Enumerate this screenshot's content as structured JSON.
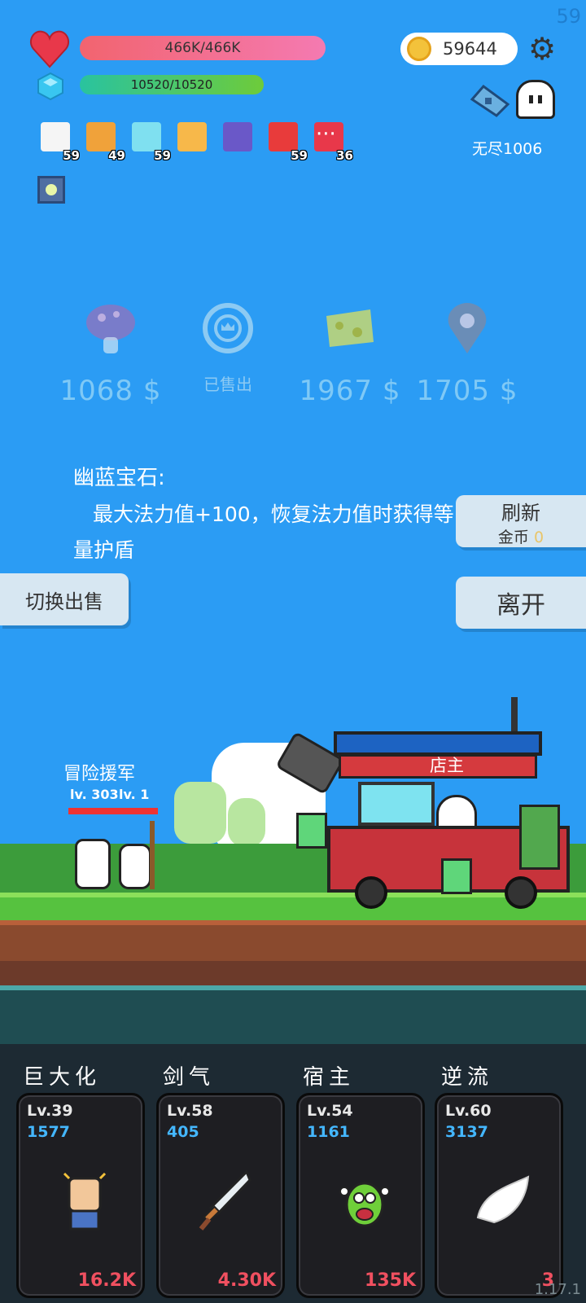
{
  "status": {
    "fps": "59",
    "version": "1.17.1"
  },
  "player": {
    "hp": "466K/466K",
    "mp": "10520/10520",
    "coins": "59644"
  },
  "mode": {
    "endless": "无尽1006"
  },
  "items": [
    {
      "icon": "flower-icon",
      "count": "59",
      "color": "#f5f5f5"
    },
    {
      "icon": "book-icon",
      "count": "49",
      "color": "#f0a23a"
    },
    {
      "icon": "sword-icon",
      "count": "59",
      "color": "#7fe0f0"
    },
    {
      "icon": "scroll-icon",
      "count": "",
      "color": "#f7b84a"
    },
    {
      "icon": "wizard-hat-icon",
      "count": "",
      "color": "#6a58c8"
    },
    {
      "icon": "apple-icon",
      "count": "59",
      "color": "#e83b3b"
    },
    {
      "icon": "heart-icon",
      "count": "36",
      "color": "#e8384a"
    }
  ],
  "more": "···",
  "shop": {
    "items": [
      {
        "icon": "mushroom-icon",
        "price": "1068 $"
      },
      {
        "icon": "crown-token-icon",
        "sold": "已售出"
      },
      {
        "icon": "cheese-icon",
        "price": "1967 $"
      },
      {
        "icon": "map-pin-icon",
        "price": "1705 $"
      }
    ],
    "desc_title": "幽蓝宝石:",
    "desc_body": "最大法力值+100，恢复法力值时获得等量护盾",
    "refresh_label": "刷新",
    "refresh_cost_label": "金币",
    "refresh_cost": "0",
    "leave_label": "离开",
    "switch_label": "切换出售"
  },
  "scene": {
    "ally_name": "冒险援军",
    "ally_lv_a": "lv. 303",
    "ally_lv_b": "lv. 1",
    "shopkeeper": "店主"
  },
  "skills": [
    {
      "name": "巨大化",
      "lv": "Lv.39",
      "power": "1577",
      "cost": "16.2K",
      "icon": "fist-icon"
    },
    {
      "name": "剑气",
      "lv": "Lv.58",
      "power": "405",
      "cost": "4.30K",
      "icon": "sword-icon"
    },
    {
      "name": "宿主",
      "lv": "Lv.54",
      "power": "1161",
      "cost": "135K",
      "icon": "virus-monster-icon"
    },
    {
      "name": "逆流",
      "lv": "Lv.60",
      "power": "3137",
      "cost": "3",
      "icon": "wing-icon"
    }
  ]
}
